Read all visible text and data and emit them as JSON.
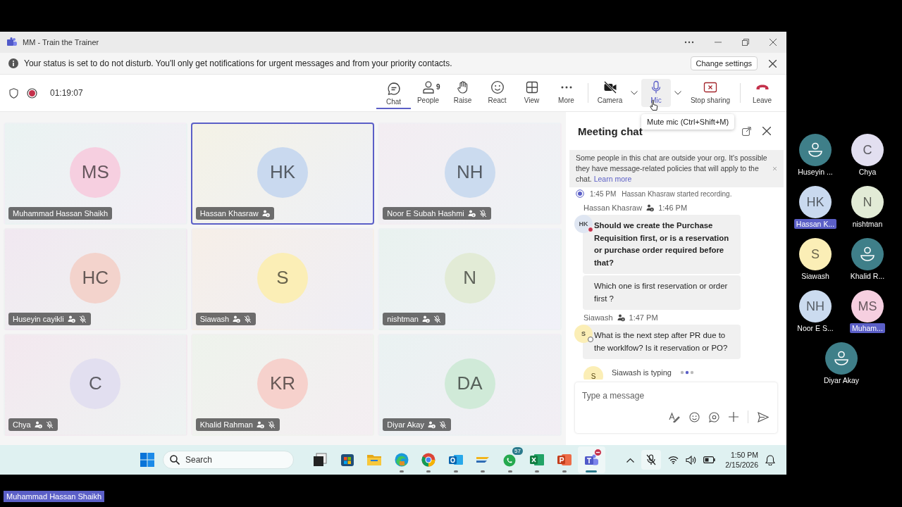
{
  "window": {
    "title": "MM - Train the Trainer"
  },
  "banner": {
    "text": "Your status is set to do not disturb. You'll only get notifications for urgent messages and from your priority contacts.",
    "button": "Change settings"
  },
  "meeting": {
    "timer": "01:19:07",
    "recording": true
  },
  "toolbar": [
    {
      "kind": "chat",
      "label": "Chat",
      "selected": true,
      "hovered": false
    },
    {
      "kind": "people",
      "label": "People",
      "count": "9",
      "selected": false,
      "hovered": false
    },
    {
      "kind": "raise",
      "label": "Raise",
      "selected": false,
      "hovered": false
    },
    {
      "kind": "react",
      "label": "React",
      "selected": false,
      "hovered": false
    },
    {
      "kind": "view",
      "label": "View",
      "selected": false,
      "hovered": false
    },
    {
      "kind": "more",
      "label": "More",
      "selected": false,
      "hovered": false
    },
    {
      "kind": "camera",
      "label": "Camera",
      "on": false,
      "dropdown": true,
      "selected": false,
      "hovered": false
    },
    {
      "kind": "mic",
      "label": "Mic",
      "on": true,
      "dropdown": true,
      "selected": false,
      "hovered": true
    },
    {
      "kind": "share",
      "label": "Stop sharing",
      "selected": false,
      "hovered": false
    },
    {
      "kind": "leave",
      "label": "Leave",
      "selected": false,
      "hovered": false
    }
  ],
  "tooltip": "Mute mic (Ctrl+Shift+M)",
  "tiles": [
    {
      "initials": "MS",
      "name": "Muhammad Hassan Shaikh",
      "color": "#f6cfe0",
      "selected": false,
      "guest": false,
      "muted": false
    },
    {
      "initials": "HK",
      "name": "Hassan Khasraw",
      "color": "#c9d9ef",
      "selected": true,
      "guest": true,
      "muted": false
    },
    {
      "initials": "NH",
      "name": "Noor E Subah Hashmi",
      "color": "#cbdbef",
      "selected": false,
      "guest": true,
      "muted": true
    },
    {
      "initials": "HC",
      "name": "Huseyin cayikli",
      "color": "#f3d3cc",
      "selected": false,
      "guest": true,
      "muted": true
    },
    {
      "initials": "S",
      "name": "Siawash",
      "color": "#fbeeb6",
      "selected": false,
      "guest": true,
      "muted": true
    },
    {
      "initials": "N",
      "name": "nishtman",
      "color": "#e2ebd6",
      "selected": false,
      "guest": true,
      "muted": true
    },
    {
      "initials": "C",
      "name": "Chya",
      "color": "#e2dff0",
      "selected": false,
      "guest": true,
      "muted": true
    },
    {
      "initials": "KR",
      "name": "Khalid Rahman",
      "color": "#f6d1cc",
      "selected": false,
      "guest": true,
      "muted": true
    },
    {
      "initials": "DA",
      "name": "Diyar Akay",
      "color": "#d0ead8",
      "selected": false,
      "guest": true,
      "muted": true
    }
  ],
  "chat": {
    "title": "Meeting chat",
    "notice": {
      "text": "Some people in this chat are outside your org. It's possible they have message-related policies that will apply to the chat.",
      "link": "Learn more"
    },
    "event": {
      "time": "1:45 PM",
      "text": "Hassan Khasraw started recording."
    },
    "messages": [
      {
        "author": "Hassan Khasraw",
        "time": "1:46 PM",
        "initials": "HK",
        "color": "#dfe6f2",
        "busy": true,
        "bubbles": [
          {
            "text": "Should we create the Purchase Requisition first, or is a reservation or purchase order required before that?",
            "bold": true
          },
          {
            "text": "Which one is first reservation or order first ?",
            "bold": false
          }
        ]
      },
      {
        "author": "Siawash",
        "time": "1:47 PM",
        "initials": "S",
        "color": "#fbeeb6",
        "busy": false,
        "bubbles": [
          {
            "text": "What is the next step after PR due to the worklfow? Is it reservation or PO?",
            "bold": false
          }
        ]
      }
    ],
    "typing": {
      "initials": "S",
      "text": "Siawash is typing"
    },
    "compose": {
      "placeholder": "Type a message"
    }
  },
  "taskbar": {
    "search": {
      "placeholder": "Search"
    },
    "apps": [
      {
        "kind": "taskview",
        "running": false,
        "active": false
      },
      {
        "kind": "store",
        "running": false,
        "active": false
      },
      {
        "kind": "explorer",
        "running": false,
        "active": false
      },
      {
        "kind": "edge",
        "running": true,
        "active": false
      },
      {
        "kind": "chrome",
        "running": true,
        "active": false
      },
      {
        "kind": "outlook",
        "running": true,
        "active": false
      },
      {
        "kind": "stripes",
        "running": true,
        "active": false
      },
      {
        "kind": "whatsapp",
        "running": true,
        "active": false,
        "badge": "57"
      },
      {
        "kind": "excel",
        "running": true,
        "active": false
      },
      {
        "kind": "powerpoint",
        "running": true,
        "active": false
      },
      {
        "kind": "teams",
        "running": true,
        "active": true,
        "alert": true
      }
    ],
    "time": "1:50 PM",
    "date": "2/15/2026"
  },
  "gallery": [
    {
      "kind": "silhouette",
      "name": "Huseyin ...",
      "color": "#3f7f89",
      "highlighted": false
    },
    {
      "kind": "initials",
      "initials": "C",
      "name": "Chya",
      "color": "#e2dff0",
      "highlighted": false
    },
    {
      "kind": "initials",
      "initials": "HK",
      "name": "Hassan K...",
      "color": "#c9d9ef",
      "highlighted": true
    },
    {
      "kind": "initials",
      "initials": "N",
      "name": "nishtman",
      "color": "#e2ebd6",
      "highlighted": false
    },
    {
      "kind": "initials",
      "initials": "S",
      "name": "Siawash",
      "color": "#fbeeb6",
      "highlighted": false
    },
    {
      "kind": "silhouette",
      "name": "Khalid R...",
      "color": "#3f7f89",
      "highlighted": false
    },
    {
      "kind": "initials",
      "initials": "NH",
      "name": "Noor E S...",
      "color": "#cbdbef",
      "highlighted": false
    },
    {
      "kind": "initials",
      "initials": "MS",
      "name": "Muham...",
      "color": "#f6cfe0",
      "highlighted": true
    },
    {
      "kind": "silhouette",
      "name": "Diyar Akay",
      "color": "#3f7f89",
      "highlighted": false
    }
  ],
  "caption": "Muhammad Hassan Shaikh"
}
